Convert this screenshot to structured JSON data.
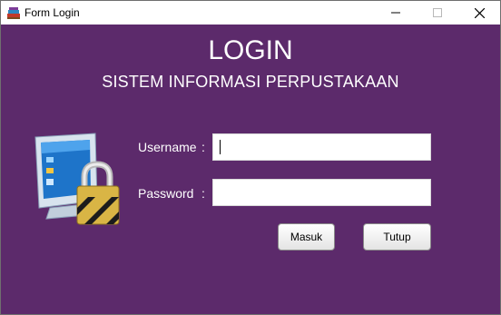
{
  "window": {
    "title": "Form Login",
    "controls": {
      "minimize": "minimize",
      "maximize": "maximize",
      "close": "close"
    }
  },
  "header": {
    "title": "LOGIN",
    "subtitle": "SISTEM INFORMASI PERPUSTAKAAN"
  },
  "form": {
    "username_label": "Username",
    "username_colon": ":",
    "username_value": "",
    "password_label": "Password",
    "password_colon": ":",
    "password_value": ""
  },
  "buttons": {
    "login_label": "Masuk",
    "close_label": "Tutup"
  },
  "icons": {
    "app": "books-icon",
    "illustration": "computer-lock-icon"
  },
  "colors": {
    "background": "#5c2a6b",
    "text": "#ffffff"
  }
}
